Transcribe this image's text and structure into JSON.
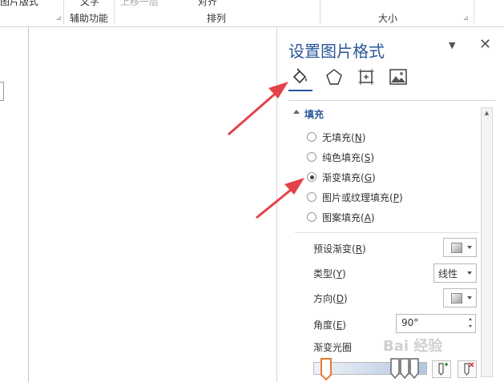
{
  "ribbon": {
    "group1_item": "图片版式",
    "group2_item": "文字",
    "group2_label": "辅助功能",
    "arrange_items": [
      "上移一层",
      "对齐"
    ],
    "arrange_label": "排列",
    "size_label": "大小"
  },
  "pane": {
    "title": "设置图片格式",
    "tabs": [
      {
        "name": "fill-line",
        "icon": "paint-bucket-icon",
        "selected": true
      },
      {
        "name": "effects",
        "icon": "pentagon-icon",
        "selected": false
      },
      {
        "name": "layout-properties",
        "icon": "size-layout-icon",
        "selected": false
      },
      {
        "name": "picture",
        "icon": "picture-icon",
        "selected": false
      }
    ],
    "section": "填充",
    "fill_options": [
      {
        "label": "无填充",
        "key": "N",
        "selected": false
      },
      {
        "label": "纯色填充",
        "key": "S",
        "selected": false
      },
      {
        "label": "渐变填充",
        "key": "G",
        "selected": true
      },
      {
        "label": "图片或纹理填充",
        "key": "P",
        "selected": false
      },
      {
        "label": "图案填充",
        "key": "A",
        "selected": false
      }
    ],
    "props": {
      "preset_label": "预设渐变",
      "preset_key": "R",
      "type_label": "类型",
      "type_key": "Y",
      "type_value": "线性",
      "direction_label": "方向",
      "direction_key": "D",
      "angle_label": "角度",
      "angle_key": "E",
      "angle_value": "90°",
      "stops_label": "渐变光圈"
    },
    "watermark": "Bai 经验"
  },
  "colors": {
    "accent": "#2b579a",
    "arrow": "#e2434b"
  }
}
